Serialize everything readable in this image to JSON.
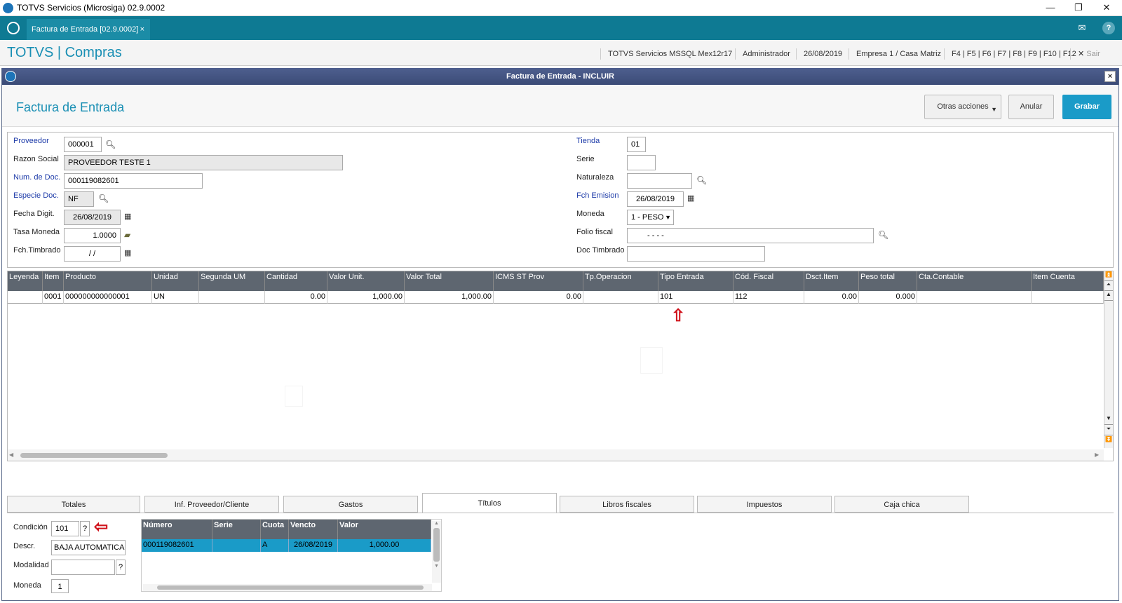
{
  "window": {
    "title": "TOTVS Servicios (Microsiga) 02.9.0002",
    "minimize": "—",
    "restore": "❐",
    "close": "✕"
  },
  "tabbar": {
    "tab_label": "Factura de Entrada [02.9.0002]",
    "tab_close": "×",
    "mail_icon": "✉",
    "help_icon": "?"
  },
  "module": {
    "title": "TOTVS | Compras",
    "server": "TOTVS Servicios MSSQL Mex12r17",
    "user": "Administrador",
    "date": "26/08/2019",
    "company": "Empresa 1 / Casa Matriz",
    "shortcuts": "F4 | F5 | F6 | F7 | F8 | F9 | F10 | F12",
    "exit": "Sair",
    "exit_icon": "✕"
  },
  "dialog": {
    "title": "Factura de Entrada - INCLUIR",
    "close": "×"
  },
  "form": {
    "title": "Factura de Entrada",
    "buttons": {
      "other": "Otras acciones",
      "cancel": "Anular",
      "save": "Grabar"
    }
  },
  "fields": {
    "proveedor": {
      "label": "Proveedor",
      "value": "000001"
    },
    "razon": {
      "label": "Razon Social",
      "value": "PROVEEDOR TESTE 1"
    },
    "numdoc": {
      "label": "Num. de Doc.",
      "value": "000119082601"
    },
    "especie": {
      "label": "Especie Doc.",
      "value": "NF"
    },
    "fechadigit": {
      "label": "Fecha Digit.",
      "value": "26/08/2019"
    },
    "tasa": {
      "label": "Tasa Moneda",
      "value": "1.0000"
    },
    "fchtimbrado": {
      "label": "Fch.Timbrado",
      "value": "/ /"
    },
    "tienda": {
      "label": "Tienda",
      "value": "01"
    },
    "serie": {
      "label": "Serie",
      "value": ""
    },
    "naturaleza": {
      "label": "Naturaleza",
      "value": ""
    },
    "fchemision": {
      "label": "Fch Emision",
      "value": "26/08/2019"
    },
    "moneda": {
      "label": "Moneda",
      "value": "1 - PESO"
    },
    "folio": {
      "label": "Folio fiscal",
      "value": "-   -   -   -"
    },
    "doctimbrado": {
      "label": "Doc Timbrado",
      "value": ""
    }
  },
  "grid": {
    "headers": [
      "Leyenda",
      "Item",
      "Producto",
      "Unidad",
      "Segunda UM",
      "Cantidad",
      "Valor Unit.",
      "Valor Total",
      "ICMS ST Prov",
      "Tp.Operacion",
      "Tipo Entrada",
      "Cód. Fiscal",
      "Dsct.Item",
      "Peso total",
      "Cta.Contable",
      "Item Cuenta"
    ],
    "row": [
      "",
      "0001",
      "000000000000001",
      "UN",
      "",
      "0.00",
      "1,000.00",
      "1,000.00",
      "0.00",
      "",
      "101",
      "112",
      "0.00",
      "0.000",
      "",
      ""
    ]
  },
  "tabs": [
    "Totales",
    "Inf. Proveedor/Cliente",
    "Gastos",
    "Títulos",
    "Libros fiscales",
    "Impuestos",
    "Caja chica"
  ],
  "titulos": {
    "condicion": {
      "label": "Condición",
      "value": "101",
      "help": "?"
    },
    "descr": {
      "label": "Descr.",
      "value": "BAJA AUTOMATICA"
    },
    "modalidad": {
      "label": "Modalidad",
      "value": "",
      "help": "?"
    },
    "moneda": {
      "label": "Moneda",
      "value": "1"
    },
    "headers": [
      "Número",
      "Serie",
      "Cuota",
      "Vencto",
      "Valor"
    ],
    "row": [
      "000119082601",
      "",
      "A",
      "26/08/2019",
      "1,000.00"
    ]
  },
  "colors": {
    "teal": "#0e7a93",
    "accent": "#1a9bc8",
    "grid_header": "#5e6670",
    "arrow": "#d0121b"
  }
}
